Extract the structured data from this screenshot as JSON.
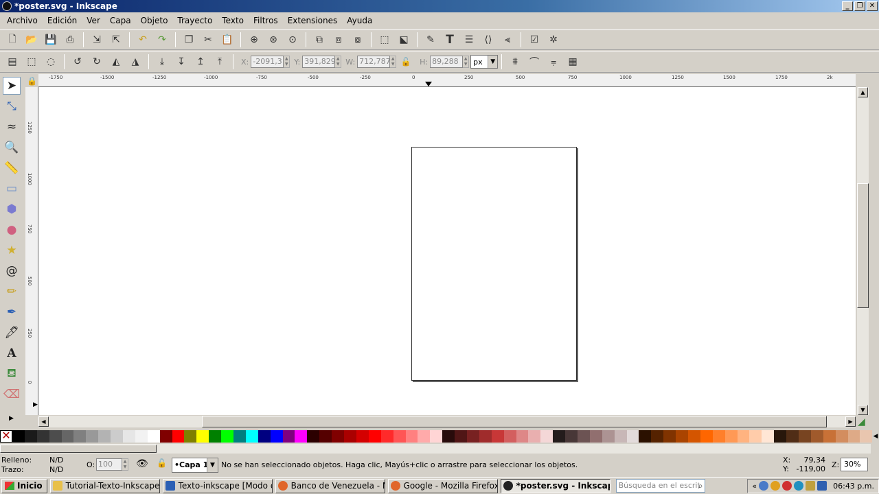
{
  "window": {
    "title": "*poster.svg - Inkscape",
    "controls": [
      "_",
      "❐",
      "✕"
    ]
  },
  "menu": [
    "Archivo",
    "Edición",
    "Ver",
    "Capa",
    "Objeto",
    "Trayecto",
    "Texto",
    "Filtros",
    "Extensiones",
    "Ayuda"
  ],
  "toolbar_top": {
    "icons": [
      "new-icon",
      "open-icon",
      "save-icon",
      "print-icon",
      "import-icon",
      "export-icon",
      "undo-icon",
      "redo-icon",
      "duplicate-icon",
      "cut-icon",
      "paste-icon",
      "zoom-selection-icon",
      "zoom-drawing-icon",
      "zoom-page-icon",
      "group-icon",
      "ungroup-icon",
      "clone-icon",
      "node-editor-icon",
      "fill-stroke-icon",
      "text-font-icon",
      "layers-icon",
      "xml-editor-icon",
      "align-icon",
      "preferences-icon",
      "document-properties-icon"
    ]
  },
  "toolbar_select": {
    "x_label": "X:",
    "x_value": "-2091,3",
    "y_label": "Y:",
    "y_value": "391,829",
    "w_label": "W:",
    "w_value": "712,787",
    "h_label": "H:",
    "h_value": "89,288",
    "unit": "px"
  },
  "rulers": {
    "h_ticks": [
      "-1750",
      "-1500",
      "-1250",
      "-1000",
      "-750",
      "-500",
      "-250",
      "0",
      "250",
      "500",
      "750",
      "1000",
      "1250",
      "1500",
      "1750",
      "2k"
    ],
    "v_ticks": [
      "1250",
      "1000",
      "750",
      "500",
      "250",
      "0"
    ]
  },
  "status": {
    "fill_label": "Relleno:",
    "fill_value": "N/D",
    "stroke_label": "Trazo:",
    "stroke_value": "N/D",
    "opacity_label": "O:",
    "opacity_value": "100",
    "layer": "•Capa 1",
    "message": "No se han seleccionado objetos. Haga clic, Mayús+clic o arrastre para seleccionar los objetos.",
    "cursor_x_label": "X:",
    "cursor_x": "79,34",
    "cursor_y_label": "Y:",
    "cursor_y": "-119,00",
    "zoom_label": "Z:",
    "zoom_value": "30%"
  },
  "palette": [
    "#000000",
    "#1a1a1a",
    "#333333",
    "#4d4d4d",
    "#666666",
    "#808080",
    "#999999",
    "#b3b3b3",
    "#cccccc",
    "#e6e6e6",
    "#f2f2f2",
    "#ffffff",
    "#800000",
    "#ff0000",
    "#808000",
    "#ffff00",
    "#008000",
    "#00ff00",
    "#008080",
    "#00ffff",
    "#000080",
    "#0000ff",
    "#800080",
    "#ff00ff",
    "#2b0000",
    "#550000",
    "#800000",
    "#aa0000",
    "#d40000",
    "#ff0000",
    "#ff2a2a",
    "#ff5555",
    "#ff8080",
    "#ffaaaa",
    "#ffd5d5",
    "#280b0b",
    "#501616",
    "#782121",
    "#a02c2c",
    "#c83737",
    "#d35f5f",
    "#de8787",
    "#e9afaf",
    "#f4d7d7",
    "#241c1c",
    "#483737",
    "#6c5353",
    "#916f6f",
    "#ac9393",
    "#c8b7b7",
    "#e3dbdb",
    "#2b1100",
    "#552200",
    "#803300",
    "#aa4400",
    "#d45500",
    "#ff6600",
    "#ff7f2a",
    "#ff9955",
    "#ffb380",
    "#ffccaa",
    "#ffe6d5",
    "#28170b",
    "#502d16",
    "#784421",
    "#a05a2c",
    "#c87137",
    "#d38d5f",
    "#deaa87",
    "#e9c6af"
  ],
  "taskbar": {
    "start_label": "Inicio",
    "tasks": [
      {
        "label": "Tutorial-Texto-Inkscape",
        "color": "#e8c04a"
      },
      {
        "label": "Texto-inkscape [Modo d...",
        "color": "#2b5fb4"
      },
      {
        "label": "Banco de Venezuela - Mo...",
        "color": "#e0662a"
      },
      {
        "label": "Google - Mozilla Firefox",
        "color": "#e0662a"
      },
      {
        "label": "*poster.svg - Inkscape",
        "color": "#222222"
      }
    ],
    "search_placeholder": "Búsqueda en el escrit",
    "tray_chevron": "«",
    "clock": "06:43 p.m."
  }
}
